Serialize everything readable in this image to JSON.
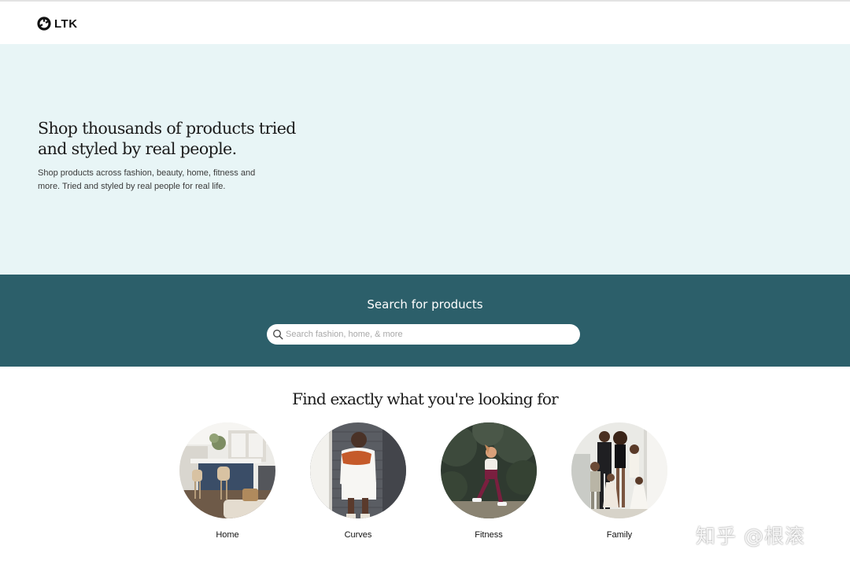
{
  "brand": {
    "logo_text": "LTK",
    "logo_icon": "ltk-logo-icon"
  },
  "hero": {
    "title": "Shop thousands of products tried and styled by real people.",
    "subtitle": "Shop products across fashion, beauty, home, fitness and more. Tried and styled by real people for real life.",
    "background_color": "#e8f5f6"
  },
  "search": {
    "title": "Search for products",
    "placeholder": "Search fashion, home, & more",
    "icon": "search-icon",
    "band_color": "#2c5f6a"
  },
  "categories_section": {
    "title": "Find exactly what you're looking for",
    "items": [
      {
        "label": "Home",
        "image": "home-category-photo"
      },
      {
        "label": "Curves",
        "image": "curves-category-photo"
      },
      {
        "label": "Fitness",
        "image": "fitness-category-photo"
      },
      {
        "label": "Family",
        "image": "family-category-photo"
      }
    ]
  },
  "watermark": {
    "text": "知乎 @根滚"
  }
}
